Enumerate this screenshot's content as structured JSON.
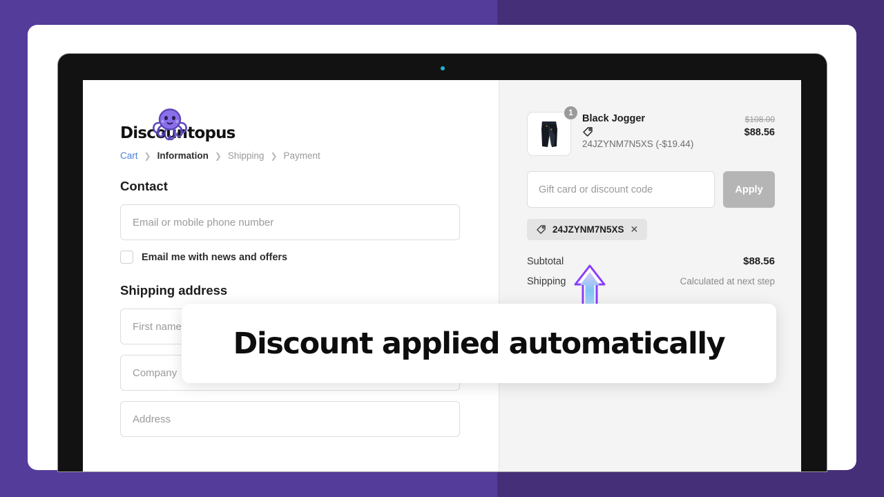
{
  "background": {
    "purple_left": "#543c9b",
    "purple_right": "#452f78"
  },
  "store": {
    "logo_text": "Discountopus",
    "logo_icon": "octopus-mascot-icon",
    "brand_purple": "#7b5ddb"
  },
  "breadcrumb": [
    {
      "label": "Cart",
      "state": "link"
    },
    {
      "label": "Information",
      "state": "current"
    },
    {
      "label": "Shipping",
      "state": "muted"
    },
    {
      "label": "Payment",
      "state": "muted"
    }
  ],
  "breadcrumb_separator": "❯",
  "contact": {
    "title": "Contact",
    "email_placeholder": "Email or mobile phone number",
    "email_value": "",
    "newsletter_label": "Email me with news and offers",
    "newsletter_checked": false
  },
  "shipping": {
    "title": "Shipping address",
    "fields": [
      {
        "name": "first-name",
        "placeholder": "First name (optional)",
        "value": ""
      },
      {
        "name": "company",
        "placeholder": "Company",
        "value": ""
      },
      {
        "name": "address",
        "placeholder": "Address",
        "value": ""
      }
    ]
  },
  "summary": {
    "product": {
      "name": "Black Jogger",
      "quantity": "1",
      "tag_icon": "price-tag-icon",
      "discount_line": "24JZYNM7N5XS (-$19.44)",
      "price_original": "$108.00",
      "price_final": "$88.56",
      "thumb_icon": "black-joggers-photo"
    },
    "discount_input_placeholder": "Gift card or discount code",
    "discount_input_value": "",
    "apply_label": "Apply",
    "apply_disabled": true,
    "applied_code": "24JZYNM7N5XS",
    "applied_code_icon": "price-tag-icon",
    "remove_icon": "✕",
    "totals": [
      {
        "label": "Subtotal",
        "value": "$88.56",
        "muted": false
      },
      {
        "label": "Shipping",
        "value": "Calculated at next step",
        "muted": true
      }
    ]
  },
  "annotation": {
    "arrow_icon": "up-arrow-icon",
    "banner_text": "Discount applied automatically"
  }
}
